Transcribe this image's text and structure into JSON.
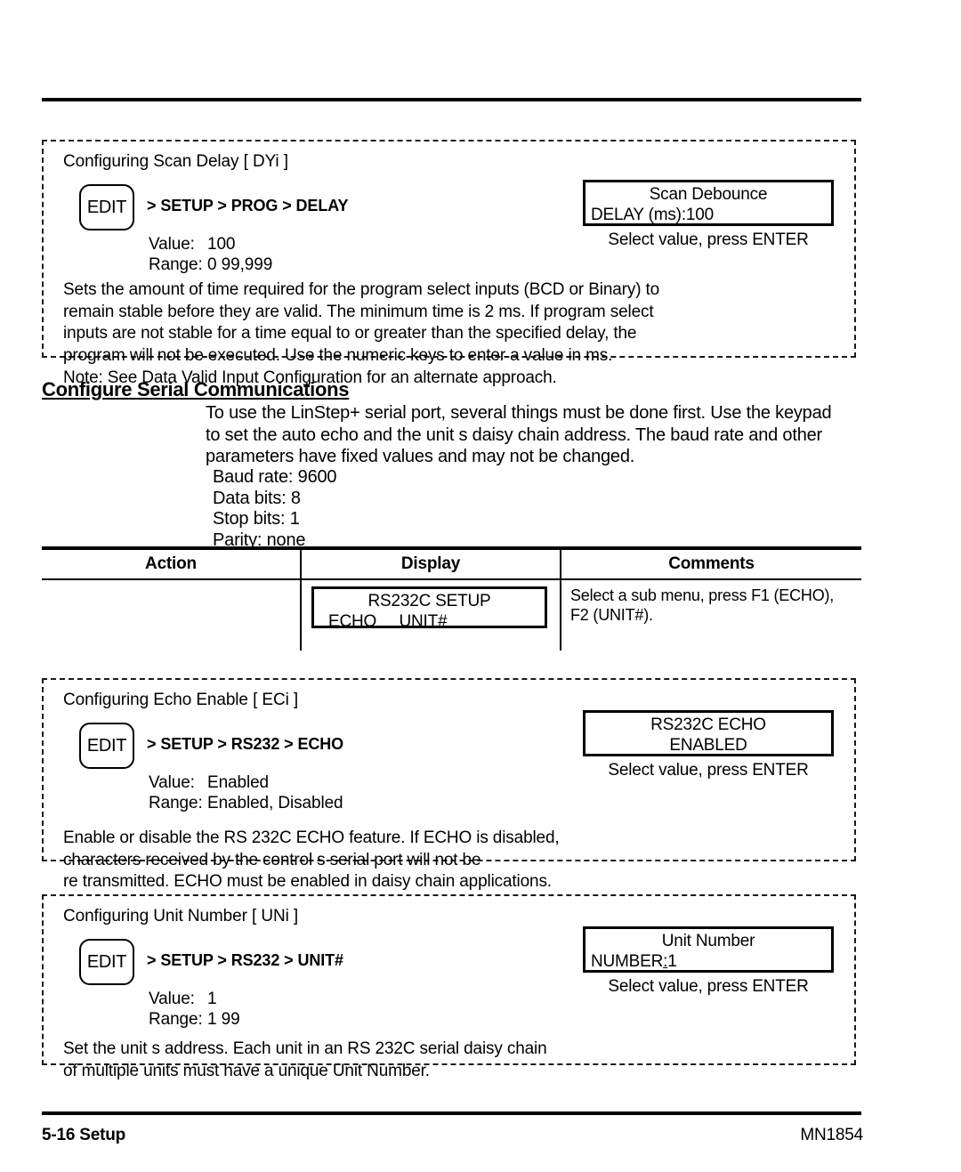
{
  "page": {
    "footer_left": "5-16 Setup",
    "footer_right": "MN1854"
  },
  "scan_delay_panel": {
    "title": "Configuring Scan Delay  [ DYi ]",
    "edit_key_label": "EDIT",
    "breadcrumb": "> SETUP > PROG > DELAY",
    "value_label": "Value:",
    "value": "100",
    "range_label": "Range:",
    "range": "0  99,999",
    "description": "Sets the amount of time required for the program select inputs (BCD or Binary) to\nremain stable before they are valid. The minimum time is 2 ms. If program select\ninputs are not stable for a time equal to or greater than the specified delay, the\nprogram will not be executed. Use the numeric keys to enter a value in ms.",
    "note": "Note:   See Data Valid Input Configuration for an alternate approach.",
    "lcd_line1": "Scan Debounce",
    "lcd_line2": "DELAY (ms):100",
    "lcd_hint": "Select value, press ENTER"
  },
  "serial_section": {
    "heading": "Configure Serial Communications",
    "intro": "To use the LinStep+ serial port, several things must be done first.  Use the keypad\nto set the auto  echo and the unit s daisy chain address.  The baud rate and other\nparameters have fixed values and may not be changed.",
    "params": "Baud rate: 9600\nData bits: 8\nStop bits: 1\nParity: none"
  },
  "table": {
    "columns": [
      "Action",
      "Display",
      "Comments"
    ],
    "row": {
      "action": "",
      "display_line1": "RS232C SETUP",
      "display_line2": "ECHO     UNIT#",
      "comments": "Select a sub  menu, press F1 (ECHO),\nF2 (UNIT#)."
    }
  },
  "echo_panel": {
    "title": "Configuring Echo Enable  [ ECi ]",
    "edit_key_label": "EDIT",
    "breadcrumb": "> SETUP > RS232 > ECHO",
    "value_label": "Value:",
    "value": "Enabled",
    "range_label": "Range:",
    "range": "Enabled, Disabled",
    "description": "Enable or disable the RS  232C ECHO feature. If ECHO is disabled,\ncharacters received by the control s serial port will not be\nre  transmitted. ECHO must be enabled in daisy  chain applications.",
    "lcd_line1": "RS232C ECHO",
    "lcd_line2": "ENABLED",
    "lcd_hint": "Select value, press ENTER"
  },
  "unit_panel": {
    "title": "Configuring Unit Number  [ UNi ]",
    "edit_key_label": "EDIT",
    "breadcrumb": "> SETUP > RS232 > UNIT#",
    "value_label": "Value:",
    "value": "1",
    "range_label": "Range:",
    "range": "1  99",
    "description": "Set the unit s address. Each unit in an RS  232C serial daisy chain\nof multiple units must have a unique Unit Number.",
    "lcd_line1": "Unit Number",
    "lcd_line2_pre": "NUMBER",
    "lcd_line2_cursor": ":",
    "lcd_line2_post": "1",
    "lcd_hint": "Select value, press ENTER"
  }
}
